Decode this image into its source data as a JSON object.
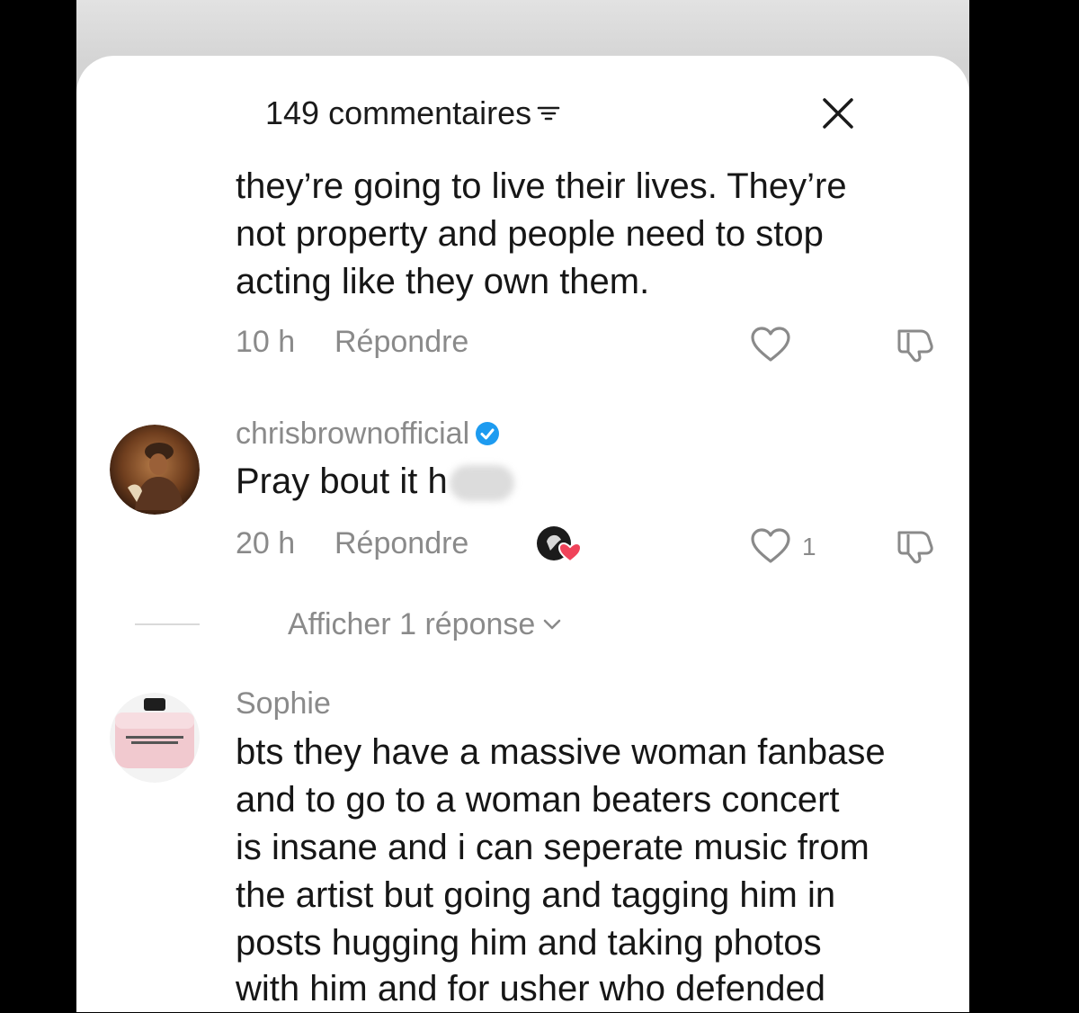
{
  "header": {
    "title": "149 commentaires"
  },
  "comments": [
    {
      "text_lines": [
        "they’re going to live their lives. They’re",
        "not property and people need to stop",
        "acting like they own them."
      ],
      "time": "10 h",
      "reply_label": "Répondre"
    },
    {
      "username": "chrisbrownofficial",
      "verified": true,
      "text": "Pray bout it h",
      "time": "20 h",
      "reply_label": "Répondre",
      "like_count": "1",
      "view_replies": "Afficher 1 réponse"
    },
    {
      "username": "Sophie",
      "text_lines": [
        "bts they have a massive woman fanbase",
        "and to go to a woman beaters concert",
        "is insane and i can seperate music from",
        "the artist but going and tagging him in",
        "posts hugging him and taking photos",
        "with him and for usher who defended"
      ]
    }
  ],
  "colors": {
    "verified_badge": "#1d9bf0",
    "creator_heart": "#f0435a"
  }
}
